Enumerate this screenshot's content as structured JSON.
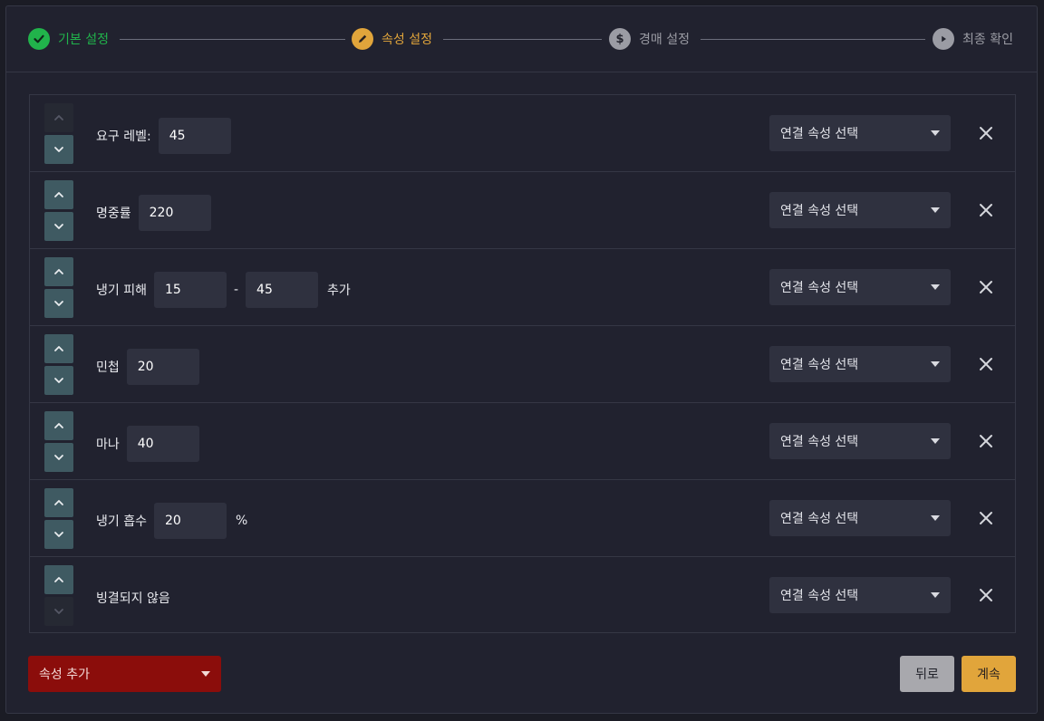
{
  "colors": {
    "accent": "#e1a53b",
    "success": "#21b34b",
    "danger": "#8b0d0b",
    "panel": "#21222f",
    "input": "#2f313f"
  },
  "stepper": {
    "steps": [
      {
        "label": "기본 설정",
        "state": "done",
        "icon": "check-icon",
        "color": "#21b34b"
      },
      {
        "label": "속성 설정",
        "state": "active",
        "icon": "pencil-icon",
        "color": "#e1a53b"
      },
      {
        "label": "경매 설정",
        "state": "pending",
        "icon": "dollar-icon",
        "color": "#9b9ca4"
      },
      {
        "label": "최종 확인",
        "state": "pending",
        "icon": "play-icon",
        "color": "#9b9ca4"
      }
    ]
  },
  "properties": [
    {
      "label": "요구 레벨:",
      "values": [
        "45"
      ],
      "link_placeholder": "연결 속성 선택",
      "up_enabled": false,
      "down_enabled": true
    },
    {
      "label": "명중률",
      "values": [
        "220"
      ],
      "link_placeholder": "연결 속성 선택",
      "up_enabled": true,
      "down_enabled": true
    },
    {
      "label": "냉기 피해",
      "values": [
        "15",
        "45"
      ],
      "separator": "-",
      "suffix": "추가",
      "link_placeholder": "연결 속성 선택",
      "up_enabled": true,
      "down_enabled": true
    },
    {
      "label": "민첩",
      "values": [
        "20"
      ],
      "link_placeholder": "연결 속성 선택",
      "up_enabled": true,
      "down_enabled": true
    },
    {
      "label": "마나",
      "values": [
        "40"
      ],
      "link_placeholder": "연결 속성 선택",
      "up_enabled": true,
      "down_enabled": true
    },
    {
      "label": "냉기 흡수",
      "values": [
        "20"
      ],
      "suffix": "%",
      "link_placeholder": "연결 속성 선택",
      "up_enabled": true,
      "down_enabled": true
    },
    {
      "label": "빙결되지 않음",
      "values": [],
      "link_placeholder": "연결 속성 선택",
      "up_enabled": true,
      "down_enabled": false
    }
  ],
  "footer": {
    "add_label": "속성 추가",
    "back_label": "뒤로",
    "continue_label": "계속"
  }
}
